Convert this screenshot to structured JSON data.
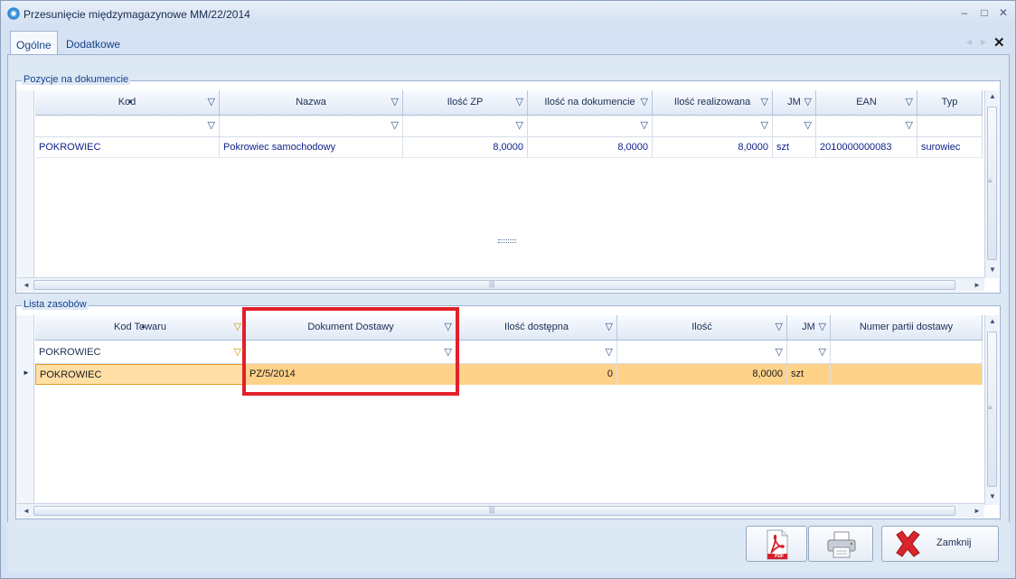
{
  "window": {
    "title": "Przesunięcie międzymagazynowe  MM/22/2014",
    "controls": {
      "minimize": "–",
      "maximize": "□",
      "close": "✕"
    }
  },
  "tabs": [
    {
      "label": "Ogólne",
      "active": true
    },
    {
      "label": "Dodatkowe",
      "active": false
    }
  ],
  "tab_controls": {
    "prev": "◄",
    "next": "►",
    "close": "✕"
  },
  "positions": {
    "caption": "Pozycje na dokumencie",
    "columns": [
      "Kod",
      "Nazwa",
      "Ilość ZP",
      "Ilość na dokumencie",
      "Ilość realizowana",
      "JM",
      "EAN",
      "Typ"
    ],
    "rows": [
      [
        "POKROWIEC",
        "Pokrowiec samochodowy",
        "8,0000",
        "8,0000",
        "8,0000",
        "szt",
        "2010000000083",
        "surowiec"
      ]
    ]
  },
  "resources": {
    "caption": "Lista zasobów",
    "columns": [
      "Kod Towaru",
      "Dokument Dostawy",
      "Ilość dostępna",
      "Ilość",
      "JM",
      "Numer partii dostawy"
    ],
    "filter_value": "POKROWIEC",
    "rows": [
      [
        "POKROWIEC",
        "PZ/5/2014",
        "0",
        "8,0000",
        "szt",
        ""
      ]
    ],
    "row_indicator": "►"
  },
  "buttons": {
    "pdf_badge": "PDF",
    "close_label": "Zamknij"
  },
  "icons": {
    "filter": "filter-icon",
    "pdf": "pdf-icon",
    "print": "printer-icon",
    "close": "red-x-icon"
  },
  "colors": {
    "selected_row": "#ffd28a",
    "highlight_box": "#e2202a",
    "data_text": "#0c1f8a"
  }
}
